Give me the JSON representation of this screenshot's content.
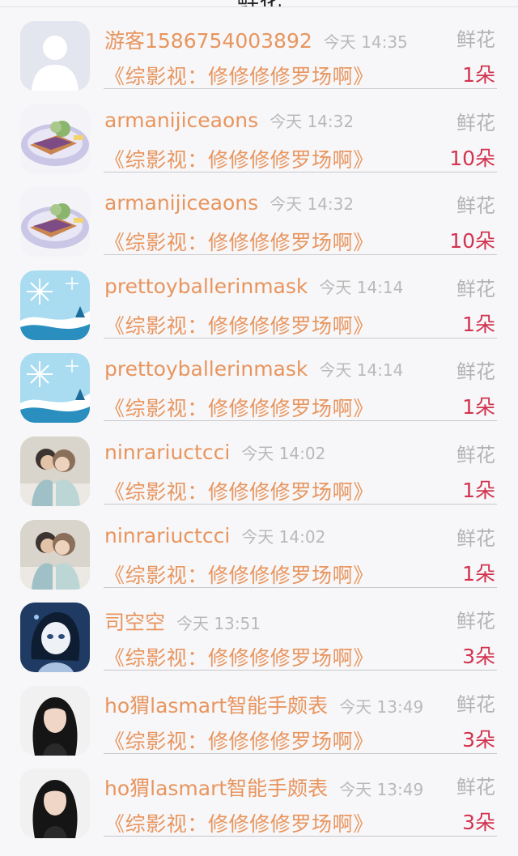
{
  "nav": {
    "title": "鲜花",
    "back": "‹"
  },
  "rows": [
    {
      "name": "游客1586754003892",
      "time": "今天 14:35",
      "type": "鲜花",
      "novel": "《综影视：修修修修罗场啊》",
      "count": "1朵",
      "avatar": "default-avatar-icon"
    },
    {
      "name": "armanijiceaons",
      "time": "今天 14:32",
      "type": "鲜花",
      "novel": "《综影视：修修修修罗场啊》",
      "count": "10朵",
      "avatar": "food-plate-avatar"
    },
    {
      "name": "armanijiceaons",
      "time": "今天 14:32",
      "type": "鲜花",
      "novel": "《综影视：修修修修罗场啊》",
      "count": "10朵",
      "avatar": "food-plate-avatar"
    },
    {
      "name": "prettoyballerinmask",
      "time": "今天 14:14",
      "type": "鲜花",
      "novel": "《综影视：修修修修罗场啊》",
      "count": "1朵",
      "avatar": "snowflake-avatar"
    },
    {
      "name": "prettoyballerinmask",
      "time": "今天 14:14",
      "type": "鲜花",
      "novel": "《综影视：修修修修罗场啊》",
      "count": "1朵",
      "avatar": "snowflake-avatar"
    },
    {
      "name": "ninrariuctcci",
      "time": "今天 14:02",
      "type": "鲜花",
      "novel": "《综影视：修修修修罗场啊》",
      "count": "1朵",
      "avatar": "couple-photo-avatar"
    },
    {
      "name": "ninrariuctcci",
      "time": "今天 14:02",
      "type": "鲜花",
      "novel": "《综影视：修修修修罗场啊》",
      "count": "1朵",
      "avatar": "couple-photo-avatar"
    },
    {
      "name": "司空空",
      "time": "今天 13:51",
      "type": "鲜花",
      "novel": "《综影视：修修修修罗场啊》",
      "count": "3朵",
      "avatar": "anime-girl-avatar"
    },
    {
      "name": "ho猬lasmart智能手颇表",
      "time": "今天 13:49",
      "type": "鲜花",
      "novel": "《综影视：修修修修罗场啊》",
      "count": "3朵",
      "avatar": "woman-portrait-avatar"
    },
    {
      "name": "ho猬lasmart智能手颇表",
      "time": "今天 13:49",
      "type": "鲜花",
      "novel": "《综影视：修修修修罗场啊》",
      "count": "3朵",
      "avatar": "woman-portrait-avatar"
    }
  ]
}
